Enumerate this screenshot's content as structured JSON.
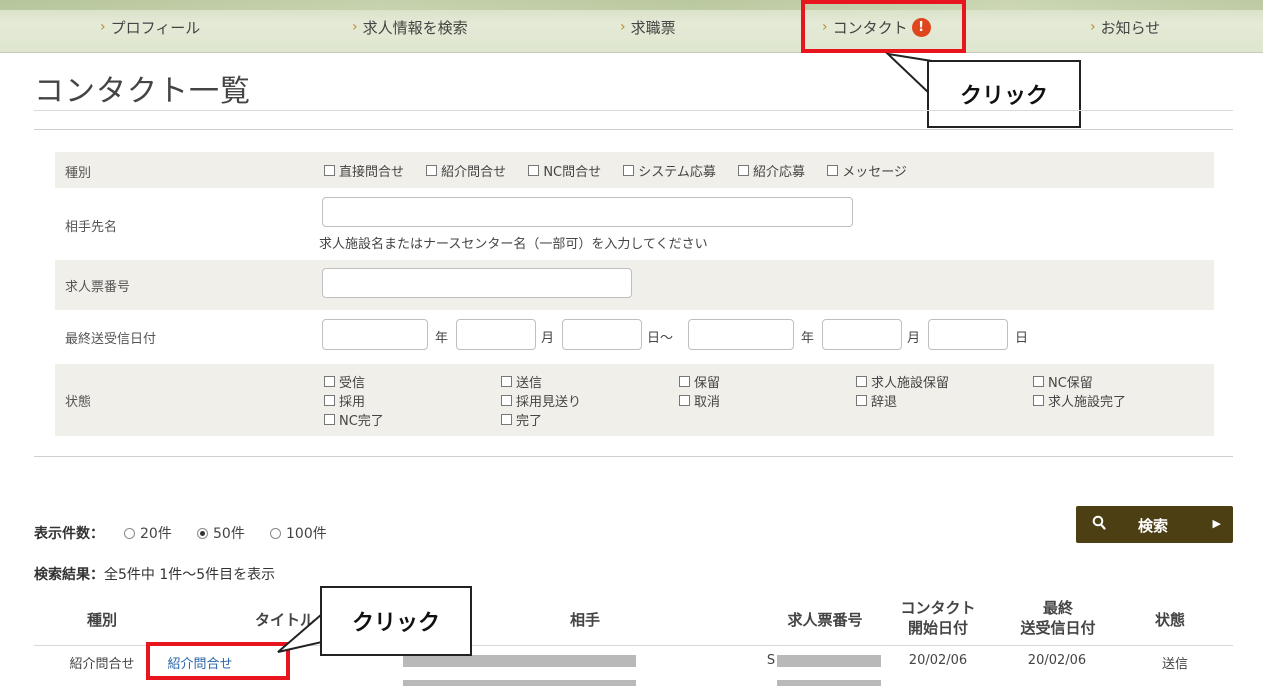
{
  "nav": {
    "items": [
      {
        "label": "プロフィール"
      },
      {
        "label": "求人情報を検索"
      },
      {
        "label": "求職票"
      },
      {
        "label": "コンタクト",
        "alert": "!"
      },
      {
        "label": "お知らせ"
      }
    ]
  },
  "callouts": {
    "nav_click": "クリック",
    "row_click": "クリック"
  },
  "page": {
    "title": "コンタクト一覧"
  },
  "form": {
    "type": {
      "label": "種別",
      "options": [
        "直接問合せ",
        "紹介問合せ",
        "NC問合せ",
        "システム応募",
        "紹介応募",
        "メッセージ"
      ]
    },
    "partner": {
      "label": "相手先名",
      "value": "",
      "hint": "求人施設名またはナースセンター名（一部可）を入力してください"
    },
    "job_number": {
      "label": "求人票番号",
      "value": ""
    },
    "date": {
      "label": "最終送受信日付",
      "from_year": "",
      "from_month": "",
      "from_day": "",
      "to_year": "",
      "to_month": "",
      "to_day": "",
      "year_unit": "年",
      "month_unit": "月",
      "day_unit_tilde": "日～",
      "day_unit": "日"
    },
    "status": {
      "label": "状態",
      "options": [
        "受信",
        "送信",
        "保留",
        "求人施設保留",
        "NC保留",
        "採用",
        "採用見送り",
        "取消",
        "辞退",
        "求人施設完了",
        "NC完了",
        "完了"
      ]
    }
  },
  "display": {
    "label": "表示件数：",
    "options": [
      "20件",
      "50件",
      "100件"
    ],
    "selected": "50件"
  },
  "search_button": {
    "label": "検索",
    "icon": "search-icon"
  },
  "result": {
    "prefix": "検索結果：",
    "text": "全5件中 1件～5件目を表示"
  },
  "table": {
    "headers": {
      "type": "種別",
      "title": "タイトル",
      "partner": "相手",
      "job_no": "求人票番号",
      "contact_start_1": "コンタクト",
      "contact_start_2": "開始日付",
      "last_1": "最終",
      "last_2": "送受信日付",
      "status": "状態"
    },
    "rows": [
      {
        "type": "紹介問合せ",
        "title": "紹介問合せ",
        "job_no": "S",
        "start_date": "20/02/06",
        "last_date": "20/02/06",
        "status": "送信"
      }
    ]
  },
  "colors": {
    "accent_red": "#e8141e",
    "button_bg": "#4c3f14",
    "link": "#2a65a8",
    "alert": "#e0461e"
  }
}
